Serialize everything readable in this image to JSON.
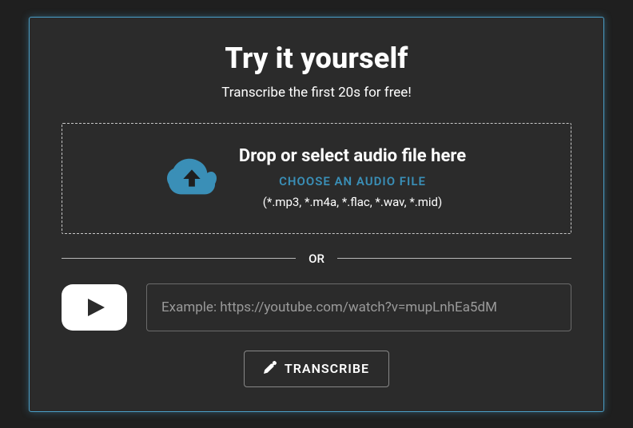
{
  "heading": {
    "title": "Try it yourself",
    "subtitle": "Transcribe the first 20s for free!"
  },
  "dropzone": {
    "headline": "Drop or select audio file here",
    "choose_label": "CHOOSE AN AUDIO FILE",
    "formats_hint": "(*.mp3, *.m4a, *.flac, *.wav, *.mid)"
  },
  "divider": {
    "label": "OR"
  },
  "youtube": {
    "placeholder": "Example: https://youtube.com/watch?v=mupLnhEa5dM",
    "value": ""
  },
  "actions": {
    "transcribe": "TRANSCRIBE"
  },
  "colors": {
    "accent": "#3a8fb7",
    "panel_border": "#4a9fc9"
  }
}
